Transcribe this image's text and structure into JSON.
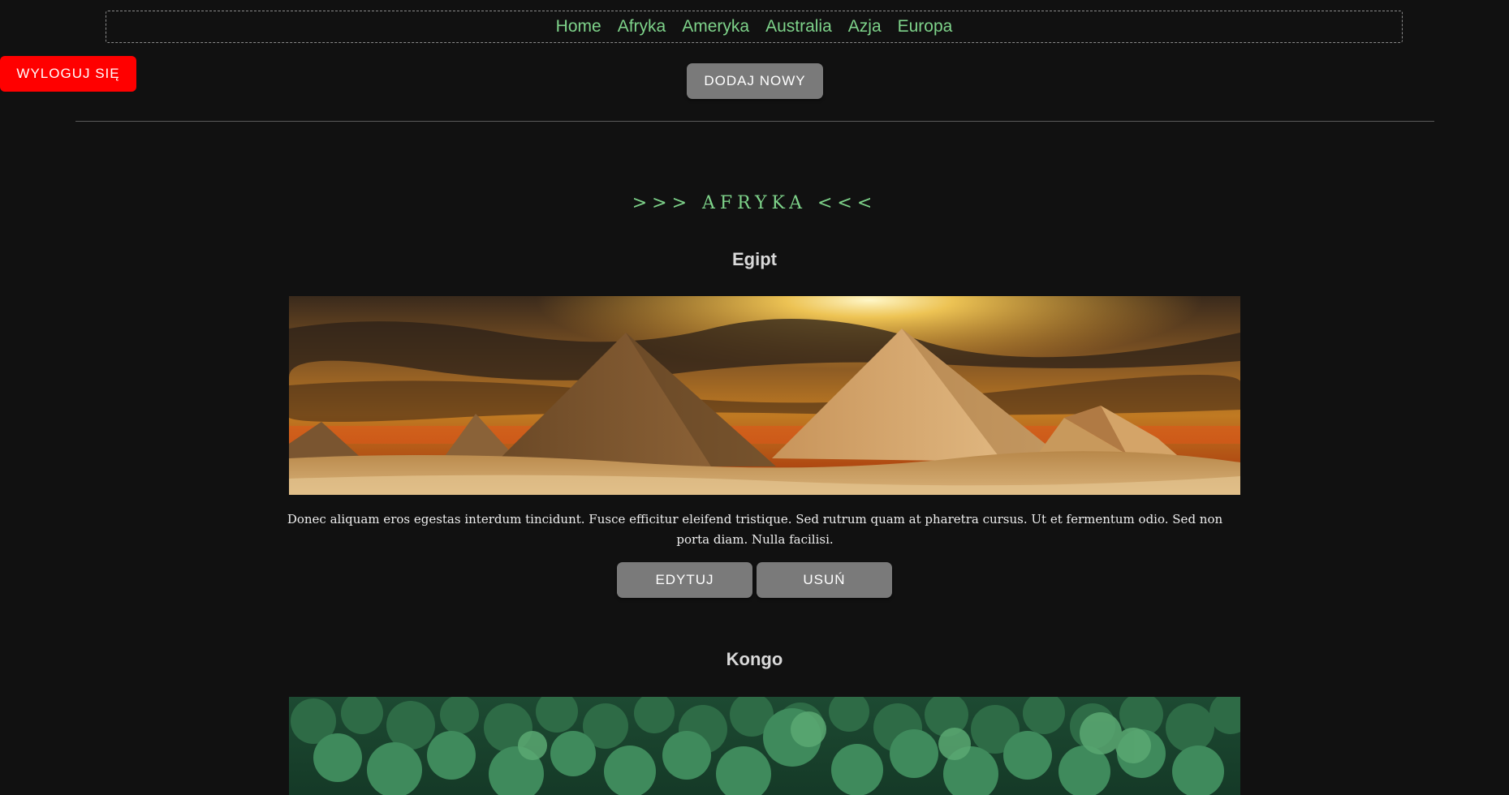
{
  "nav": {
    "items": [
      "Home",
      "Afryka",
      "Ameryka",
      "Australia",
      "Azja",
      "Europa"
    ]
  },
  "auth": {
    "logout_label": "WYLOGUJ SIĘ"
  },
  "toolbar": {
    "add_new_label": "DODAJ NOWY"
  },
  "section": {
    "title": ">>> AFRYKA <<<"
  },
  "countries": [
    {
      "name": "Egipt",
      "description": "Donec aliquam eros egestas interdum tincidunt. Fusce efficitur eleifend tristique. Sed rutrum quam at pharetra cursus. Ut et fermentum odio. Sed non porta diam. Nulla facilisi.",
      "edit_label": "EDYTUJ",
      "delete_label": "USUŃ"
    },
    {
      "name": "Kongo"
    }
  ],
  "colors": {
    "background": "#111111",
    "accent_green": "#7ed38a",
    "logout_red": "#ff0000",
    "button_gray": "#7a7a7a"
  }
}
